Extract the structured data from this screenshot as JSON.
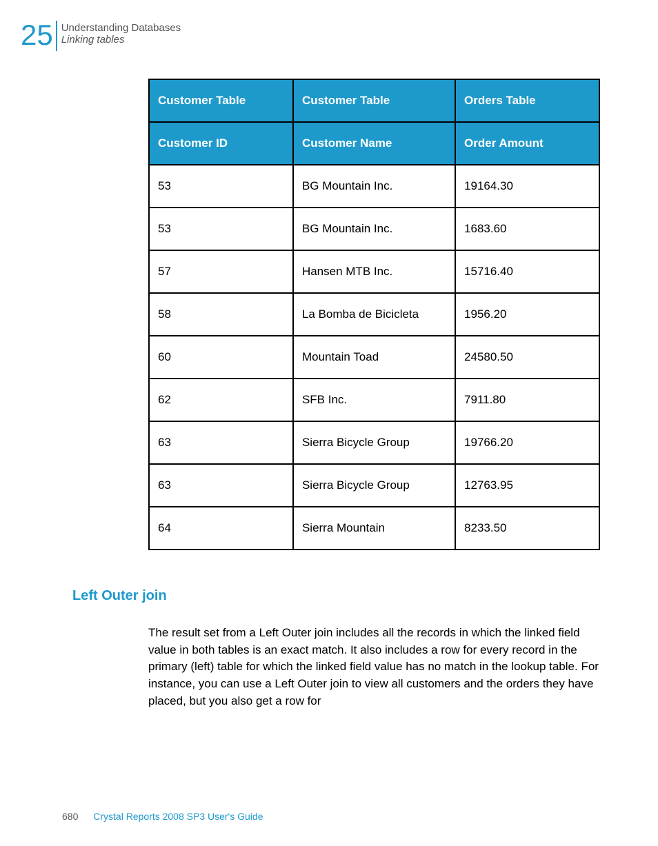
{
  "header": {
    "chapter_number": "25",
    "chapter_title": "Understanding Databases",
    "section_title": "Linking tables"
  },
  "table": {
    "header_row1": [
      "Customer Table",
      "Customer Table",
      "Orders Table"
    ],
    "header_row2": [
      "Customer ID",
      "Customer Name",
      "Order Amount"
    ],
    "rows": [
      [
        "53",
        "BG Mountain Inc.",
        "19164.30"
      ],
      [
        "53",
        "BG Mountain Inc.",
        "1683.60"
      ],
      [
        "57",
        "Hansen MTB Inc.",
        "15716.40"
      ],
      [
        "58",
        "La Bomba de Bicicleta",
        "1956.20"
      ],
      [
        "60",
        "Mountain Toad",
        "24580.50"
      ],
      [
        "62",
        "SFB Inc.",
        "7911.80"
      ],
      [
        "63",
        "Sierra Bicycle Group",
        "19766.20"
      ],
      [
        "63",
        "Sierra Bicycle Group",
        "12763.95"
      ],
      [
        "64",
        "Sierra Mountain",
        "8233.50"
      ]
    ]
  },
  "section": {
    "heading": "Left Outer join",
    "body": "The result set from a Left Outer join includes all the records in which the linked field value in both tables is an exact match. It also includes a row for every record in the primary (left) table for which the linked field value has no match in the lookup table. For instance, you can use a Left Outer join to view all customers and the orders they have placed, but you also get a row for"
  },
  "footer": {
    "page": "680",
    "title": "Crystal Reports 2008 SP3 User's Guide"
  }
}
